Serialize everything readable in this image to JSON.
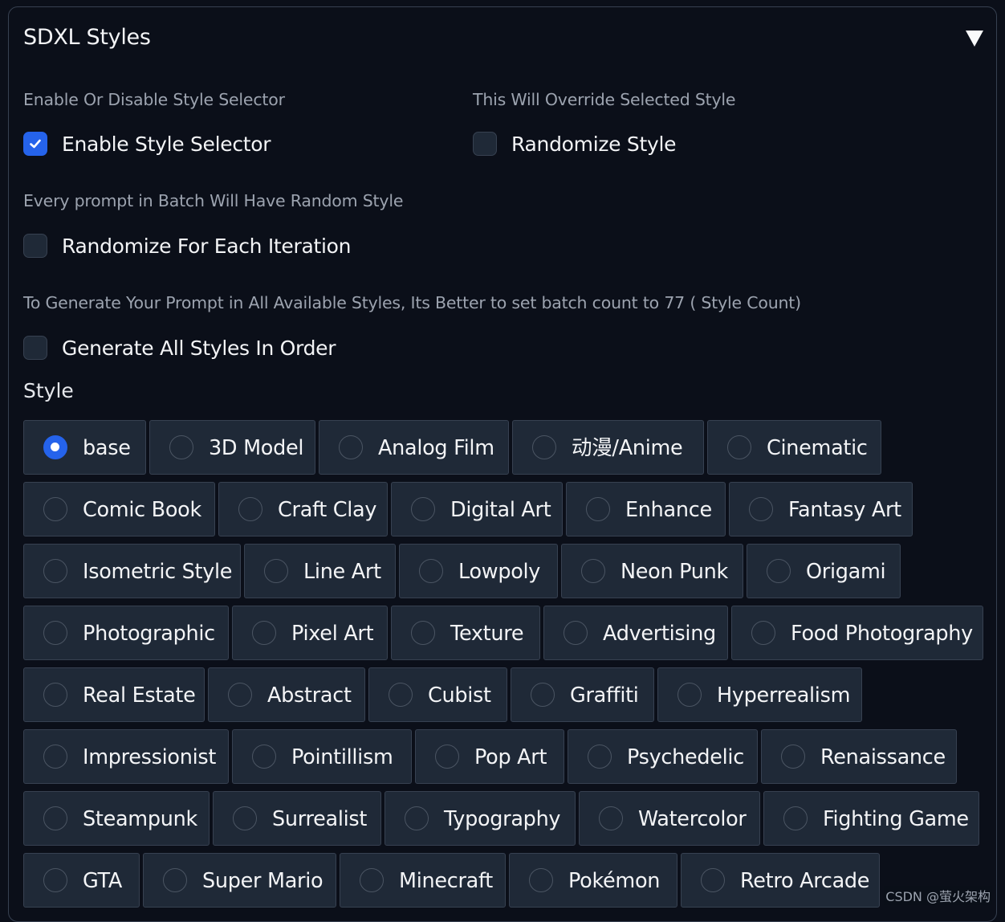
{
  "panel": {
    "title": "SDXL Styles",
    "collapse_icon": "triangle-down-icon"
  },
  "options": {
    "enable": {
      "info": "Enable Or Disable Style Selector",
      "label": "Enable Style Selector",
      "checked": true
    },
    "randomize": {
      "info": "This Will Override Selected Style",
      "label": "Randomize Style",
      "checked": false
    },
    "randomize_each": {
      "info": "Every prompt in Batch Will Have Random Style",
      "label": "Randomize For Each Iteration",
      "checked": false
    },
    "generate_all": {
      "info": "To Generate Your Prompt in All Available Styles, Its Better to set batch count to 77 ( Style Count)",
      "label": "Generate All Styles In Order",
      "checked": false
    }
  },
  "style": {
    "label": "Style",
    "selected": "base",
    "rows": [
      [
        "base",
        "3D Model",
        "Analog Film",
        "动漫/Anime",
        "Cinematic"
      ],
      [
        "Comic Book",
        "Craft Clay",
        "Digital Art",
        "Enhance",
        "Fantasy Art"
      ],
      [
        "Isometric Style",
        "Line Art",
        "Lowpoly",
        "Neon Punk",
        "Origami"
      ],
      [
        "Photographic",
        "Pixel Art",
        "Texture",
        "Advertising",
        "Food Photography"
      ],
      [
        "Real Estate",
        "Abstract",
        "Cubist",
        "Graffiti",
        "Hyperrealism"
      ],
      [
        "Impressionist",
        "Pointillism",
        "Pop Art",
        "Psychedelic",
        "Renaissance"
      ],
      [
        "Steampunk",
        "Surrealist",
        "Typography",
        "Watercolor",
        "Fighting Game"
      ],
      [
        "GTA",
        "Super Mario",
        "Minecraft",
        "Pokémon",
        "Retro Arcade"
      ]
    ]
  },
  "watermark": "CSDN @萤火架构",
  "colors": {
    "background": "#0b0f19",
    "accent": "#2563eb",
    "item_bg": "#1f2937",
    "border": "#374151"
  }
}
